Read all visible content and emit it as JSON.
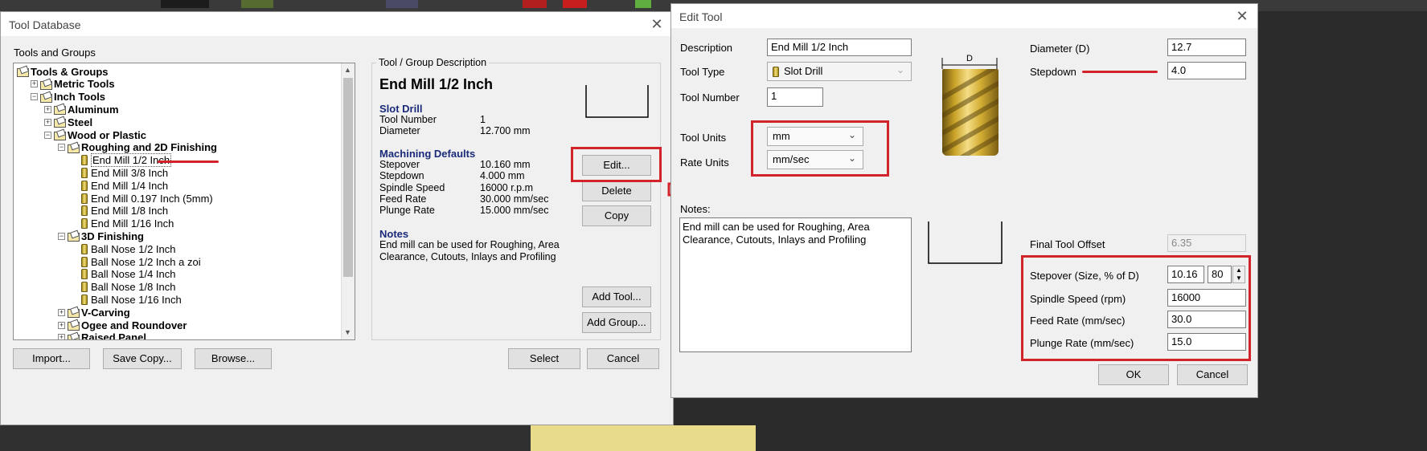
{
  "tool_database": {
    "title": "Tool Database",
    "tools_and_groups_label": "Tools and Groups",
    "tree": [
      {
        "label": "Tools & Groups",
        "indent": 0,
        "expander": "",
        "icon": "folder",
        "bold": true
      },
      {
        "label": "Metric Tools",
        "indent": 1,
        "expander": "+",
        "icon": "folder",
        "bold": true
      },
      {
        "label": "Inch Tools",
        "indent": 1,
        "expander": "−",
        "icon": "folder",
        "bold": true
      },
      {
        "label": "Aluminum",
        "indent": 2,
        "expander": "+",
        "icon": "folder",
        "bold": true
      },
      {
        "label": "Steel",
        "indent": 2,
        "expander": "+",
        "icon": "folder",
        "bold": true
      },
      {
        "label": "Wood or Plastic",
        "indent": 2,
        "expander": "−",
        "icon": "folder",
        "bold": true
      },
      {
        "label": "Roughing and 2D Finishing",
        "indent": 3,
        "expander": "−",
        "icon": "folder",
        "bold": true
      },
      {
        "label": "End Mill 1/2 Inch",
        "indent": 4,
        "expander": "",
        "icon": "tool",
        "bold": false,
        "selected": true
      },
      {
        "label": "End Mill 3/8 Inch",
        "indent": 4,
        "expander": "",
        "icon": "tool",
        "bold": false
      },
      {
        "label": "End Mill 1/4 Inch",
        "indent": 4,
        "expander": "",
        "icon": "tool",
        "bold": false
      },
      {
        "label": "End Mill 0.197 Inch (5mm)",
        "indent": 4,
        "expander": "",
        "icon": "tool",
        "bold": false
      },
      {
        "label": "End Mill 1/8 Inch",
        "indent": 4,
        "expander": "",
        "icon": "tool",
        "bold": false
      },
      {
        "label": "End Mill 1/16 Inch",
        "indent": 4,
        "expander": "",
        "icon": "tool",
        "bold": false
      },
      {
        "label": "3D Finishing",
        "indent": 3,
        "expander": "−",
        "icon": "folder",
        "bold": true
      },
      {
        "label": "Ball Nose 1/2 Inch",
        "indent": 4,
        "expander": "",
        "icon": "tool",
        "bold": false
      },
      {
        "label": "Ball Nose 1/2 Inch a zoi",
        "indent": 4,
        "expander": "",
        "icon": "tool",
        "bold": false
      },
      {
        "label": "Ball Nose 1/4 Inch",
        "indent": 4,
        "expander": "",
        "icon": "tool",
        "bold": false
      },
      {
        "label": "Ball Nose 1/8 Inch",
        "indent": 4,
        "expander": "",
        "icon": "tool",
        "bold": false
      },
      {
        "label": "Ball Nose 1/16 Inch",
        "indent": 4,
        "expander": "",
        "icon": "tool",
        "bold": false
      },
      {
        "label": "V-Carving",
        "indent": 3,
        "expander": "+",
        "icon": "folder",
        "bold": true
      },
      {
        "label": "Ogee and Roundover",
        "indent": 3,
        "expander": "+",
        "icon": "folder",
        "bold": true
      },
      {
        "label": "Raised Panel",
        "indent": 3,
        "expander": "+",
        "icon": "folder",
        "bold": true
      }
    ],
    "group_description_label": "Tool / Group Description",
    "tool_name": "End Mill 1/2 Inch",
    "tool_type": "Slot Drill",
    "info": [
      {
        "label": "Tool Number",
        "value": "1"
      },
      {
        "label": "Diameter",
        "value": "12.700 mm"
      }
    ],
    "machining_defaults_heading": "Machining Defaults",
    "machining": [
      {
        "label": "Stepover",
        "value": "10.160 mm"
      },
      {
        "label": "Stepdown",
        "value": "4.000 mm"
      },
      {
        "label": "Spindle Speed",
        "value": "16000 r.p.m"
      },
      {
        "label": "Feed Rate",
        "value": "30.000 mm/sec"
      },
      {
        "label": "Plunge Rate",
        "value": "15.000 mm/sec"
      }
    ],
    "notes_heading": "Notes",
    "notes_line1": "End mill can be used for Roughing, Area",
    "notes_line2": "Clearance, Cutouts, Inlays and Profiling",
    "buttons": {
      "edit": "Edit...",
      "delete": "Delete",
      "copy": "Copy",
      "add_tool": "Add Tool...",
      "add_group": "Add Group...",
      "import": "Import...",
      "save_copy": "Save Copy...",
      "browse": "Browse...",
      "select": "Select",
      "cancel": "Cancel"
    }
  },
  "edit_tool": {
    "title": "Edit Tool",
    "description_label": "Description",
    "description_value": "End Mill 1/2 Inch",
    "tool_type_label": "Tool Type",
    "tool_type_value": "Slot Drill",
    "tool_number_label": "Tool Number",
    "tool_number_value": "1",
    "tool_units_label": "Tool Units",
    "tool_units_value": "mm",
    "rate_units_label": "Rate Units",
    "rate_units_value": "mm/sec",
    "notes_label": "Notes:",
    "notes_value": "End mill can be used for Roughing, Area Clearance, Cutouts, Inlays and Profiling",
    "diagram_d_label": "D",
    "diameter_label": "Diameter (D)",
    "diameter_value": "12.7",
    "stepdown_label": "Stepdown",
    "stepdown_value": "4.0",
    "final_offset_label": "Final Tool Offset",
    "final_offset_value": "6.35",
    "stepover_label": "Stepover (Size, % of D)",
    "stepover_size": "10.16",
    "stepover_percent": "80",
    "spindle_label": "Spindle Speed (rpm)",
    "spindle_value": "16000",
    "feed_label": "Feed Rate (mm/sec)",
    "feed_value": "30.0",
    "plunge_label": "Plunge Rate (mm/sec)",
    "plunge_value": "15.0",
    "ok_label": "OK",
    "cancel_label": "Cancel"
  },
  "colors": {
    "annotation_red": "#d2232a",
    "section_heading": "#1a2a7a"
  }
}
